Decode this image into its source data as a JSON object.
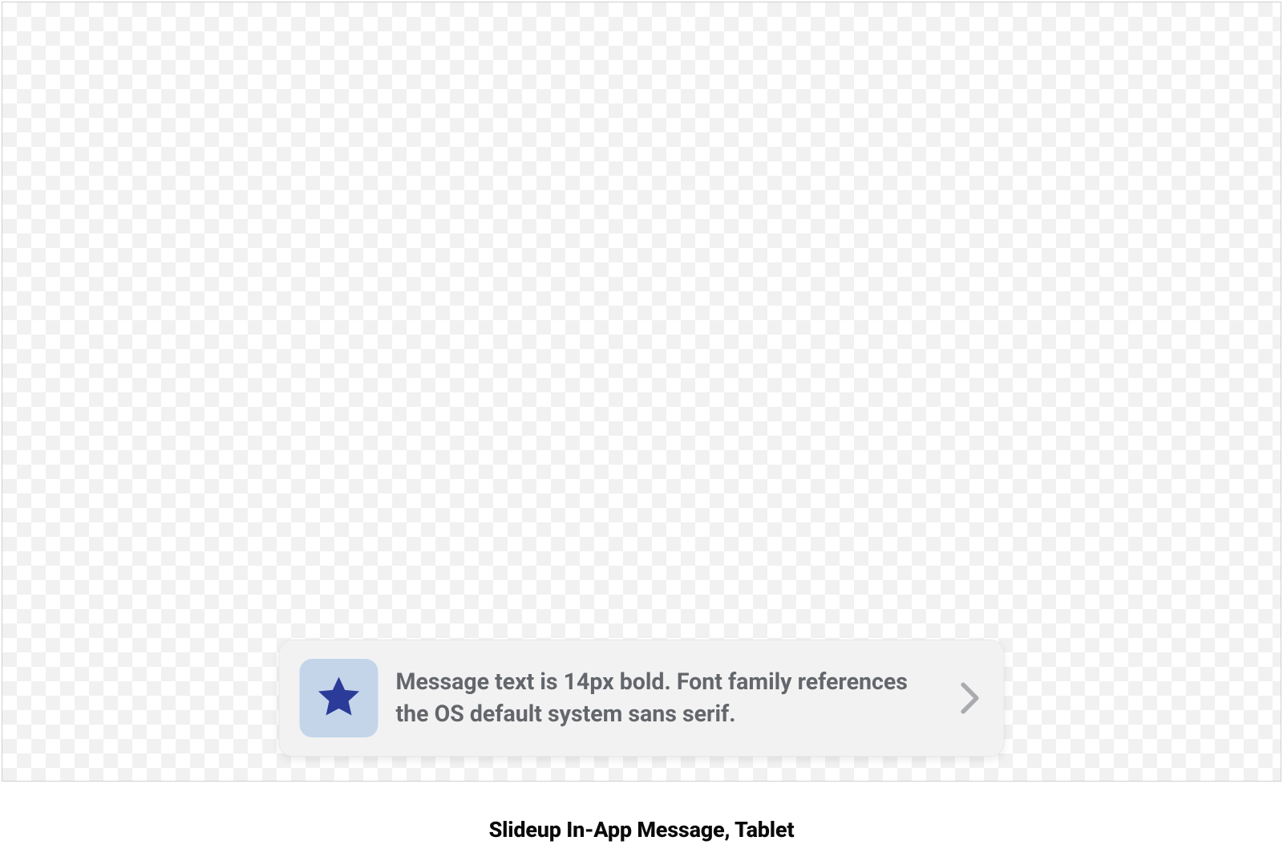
{
  "caption": "Slideup In-App Message, Tablet",
  "slideup": {
    "icon": "star-icon",
    "message": "Message text is 14px bold. Font family references the OS default system sans serif.",
    "colors": {
      "icon_bg": "#c4d5ea",
      "icon_fill": "#2b3b99",
      "panel_bg": "#f2f2f3",
      "text": "#63666a",
      "chevron": "#a9abae"
    }
  }
}
